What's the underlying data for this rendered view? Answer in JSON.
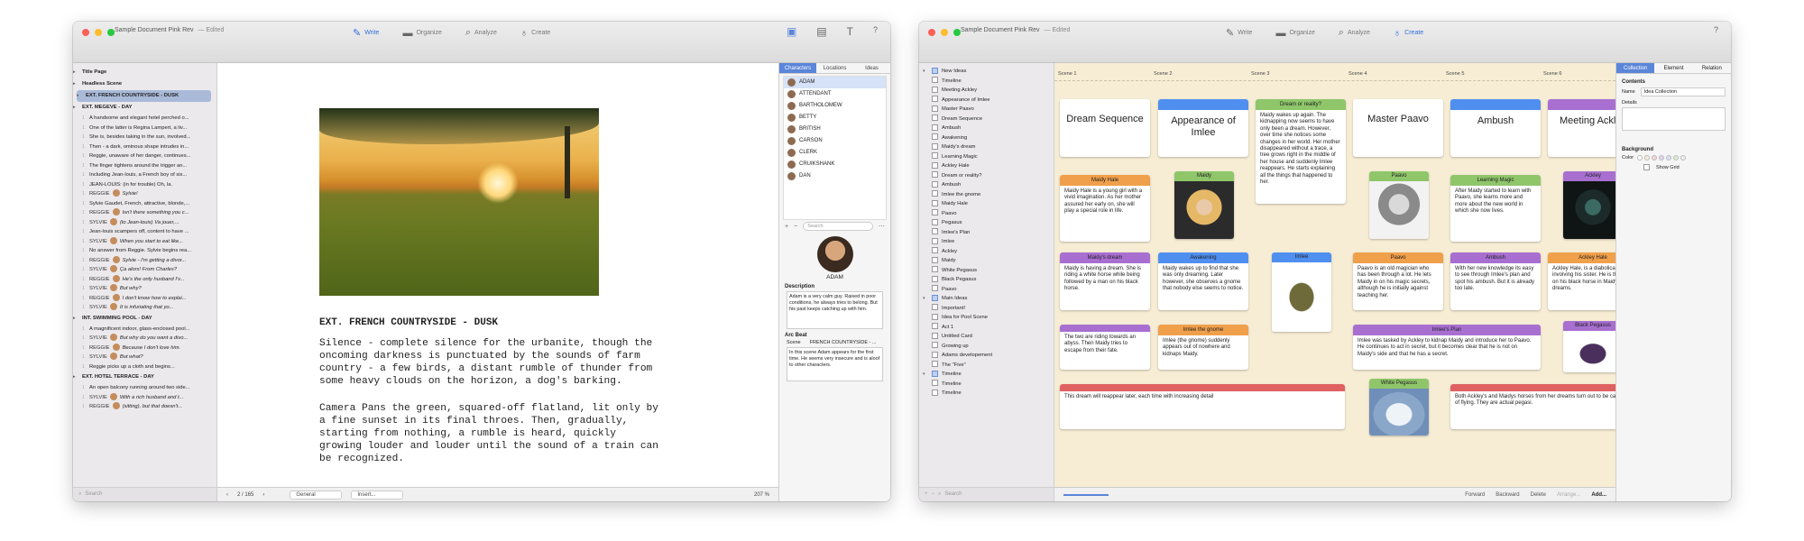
{
  "window1": {
    "title": "Sample Document Pink Rev",
    "edited": "— Edited",
    "modes": [
      "Write",
      "Organize",
      "Analyze",
      "Create"
    ],
    "binder": [
      {
        "label": "Title Page",
        "type": "hdr"
      },
      {
        "label": "Headless Scene",
        "type": "hdr"
      },
      {
        "label": "EXT. FRENCH COUNTRYSIDE - DUSK",
        "type": "sel"
      },
      {
        "label": "EXT. MEGEVE - DAY",
        "type": "hdr"
      },
      {
        "label": "A handsome and elegant hotel perched o...",
        "num": "1"
      },
      {
        "label": "One of the latter is Regina Lampert, a liv...",
        "num": "1"
      },
      {
        "label": "She is, besides taking in the sun, involved...",
        "num": "1"
      },
      {
        "label": "Then - a dark, ominous shape intrudes in...",
        "num": "1"
      },
      {
        "label": "Reggie, unaware of her danger, continues...",
        "num": "1"
      },
      {
        "label": "The finger tightens around the trigger an...",
        "num": "1"
      },
      {
        "label": "Including Jean-louis, a French boy of six...",
        "num": "1"
      },
      {
        "label": "JEAN-LOUIS: (in for trouble)  Oh, la.",
        "num": "1"
      },
      {
        "label": "Sylvie!",
        "num": "1",
        "char": "REGGIE",
        "av": true
      },
      {
        "label": "Sylvie Gaudet, French, attractive, blonde,...",
        "num": "1"
      },
      {
        "label": "Isn't there something you c...",
        "num": "1",
        "char": "REGGIE",
        "av": true
      },
      {
        "label": "(to Jean-louis)  Va jouer,...",
        "num": "1",
        "char": "SYLVIE",
        "av": true
      },
      {
        "label": "Jean-louis scampers off, content to have ...",
        "num": "1"
      },
      {
        "label": "When you start to eat like...",
        "num": "1",
        "char": "SYLVIE",
        "av": true
      },
      {
        "label": "No answer from Reggie. Sylvie begins rea...",
        "num": "1"
      },
      {
        "label": "Sylvie - I'm getting a divor...",
        "num": "1",
        "char": "REGGIE",
        "av": true
      },
      {
        "label": "Ça alors! From Charles?",
        "num": "1",
        "char": "SYLVIE",
        "av": true
      },
      {
        "label": "He's the only husband I'v...",
        "num": "1",
        "char": "REGGIE",
        "av": true
      },
      {
        "label": "But why?",
        "num": "1",
        "char": "SYLVIE",
        "av": true
      },
      {
        "label": "I don't know how to explai...",
        "num": "1",
        "char": "REGGIE",
        "av": true
      },
      {
        "label": "It is infuriating that yo...",
        "num": "1",
        "char": "SYLVIE",
        "av": true
      },
      {
        "label": "INT. SWIMMING POOL - DAY",
        "type": "hdr"
      },
      {
        "label": "A magnificent indoor, glass-enclosed pool...",
        "num": "1"
      },
      {
        "label": "But why do you want a divo...",
        "num": "1",
        "char": "SYLVIE",
        "av": true
      },
      {
        "label": "Because I don't love him.",
        "num": "1",
        "char": "REGGIE",
        "av": true
      },
      {
        "label": "But what?",
        "num": "1",
        "char": "SYLVIE",
        "av": true
      },
      {
        "label": "Reggie picks up a cloth and begins...",
        "num": "1"
      },
      {
        "label": "EXT. HOTEL TERRACE - DAY",
        "type": "hdr"
      },
      {
        "label": "An open balcony running around two side...",
        "num": "1"
      },
      {
        "label": "With a rich husband and t...",
        "num": "1",
        "char": "SYLVIE",
        "av": true
      },
      {
        "label": "(sitting), but that doesn't...",
        "num": "1",
        "char": "REGGIE",
        "av": true
      }
    ],
    "search_placeholder": "Search",
    "scene_heading": "EXT. FRENCH COUNTRYSIDE - DUSK",
    "paragraphs": [
      "Silence - complete silence for the urbanite, though the oncoming darkness is punctuated by the sounds of farm country - a few birds, a distant rumble of thunder from some heavy clouds on the horizon, a dog's barking.",
      "Camera Pans the green, squared-off flatland, lit only by a fine sunset in its final throes. Then, gradually, starting from nothing, a rumble is heard, quickly growing louder and louder until the sound of a train can be recognized."
    ],
    "footer": {
      "page": "2 / 165",
      "style": "General",
      "insert": "Insert...",
      "zoom": "207 %"
    },
    "inspector": {
      "tabs": [
        "Characters",
        "Locations",
        "Ideas"
      ],
      "characters": [
        "ADAM",
        "ATTENDANT",
        "BARTHOLOMEW",
        "BETTY",
        "BRITISH",
        "CARSON",
        "CLERK",
        "CRUIKSHANK",
        "DAN"
      ],
      "search_placeholder": "Search",
      "selected_name": "ADAM",
      "description_label": "Description",
      "description": "Adam is a very calm guy. Raised in poor conditions, he always tries to belong. But his past keeps catching up with him.",
      "arc_label": "Arc Beat",
      "scene_label": "Scene",
      "scene_value": "FRENCH COUNTRYSIDE - ...",
      "arc_text": "In this scene Adam appears for the first time. He seems very insecure and is aloof to other characters."
    }
  },
  "window2": {
    "title": "Sample Document Pink Rev",
    "edited": "— Edited",
    "modes": [
      "Write",
      "Organize",
      "Analyze",
      "Create"
    ],
    "binder": [
      {
        "label": "New Ideas",
        "type": "folder"
      },
      {
        "label": "Timeline"
      },
      {
        "label": "Meeting Ackley"
      },
      {
        "label": "Appearance of Imlee"
      },
      {
        "label": "Master Paavo"
      },
      {
        "label": "Dream Sequence"
      },
      {
        "label": "Ambush"
      },
      {
        "label": "Awakening"
      },
      {
        "label": "Maidy's dream"
      },
      {
        "label": "Learning Magic"
      },
      {
        "label": "Ackley Hale"
      },
      {
        "label": "Dream or reality?"
      },
      {
        "label": "Ambush"
      },
      {
        "label": "Imlee the gnome"
      },
      {
        "label": "Maidy Hale"
      },
      {
        "label": "Paavo"
      },
      {
        "label": "Pegasus"
      },
      {
        "label": "Imlee's Plan"
      },
      {
        "label": "Imlee"
      },
      {
        "label": "Ackley"
      },
      {
        "label": "Maidy"
      },
      {
        "label": "White Pegasus"
      },
      {
        "label": "Black Pegasus"
      },
      {
        "label": "Paavo"
      },
      {
        "label": "Main Ideas",
        "type": "folder"
      },
      {
        "label": "Important!"
      },
      {
        "label": "Idea for Pool Scene"
      },
      {
        "label": "Act 1"
      },
      {
        "label": "Untitled Card"
      },
      {
        "label": "Growing up"
      },
      {
        "label": "Adams developement"
      },
      {
        "label": "The \"Five\""
      },
      {
        "label": "Timeline",
        "type": "folder"
      },
      {
        "label": "Timeline"
      },
      {
        "label": "Timeline"
      }
    ],
    "search_placeholder": "Search",
    "scenes": [
      "Scene 1",
      "Scene 2",
      "Scene 3",
      "Scene 4",
      "Scene 5",
      "Scene 6"
    ],
    "cards": {
      "dream_sequence": {
        "title": "Dream Sequence"
      },
      "appearance": {
        "title": "Appearance of Imlee"
      },
      "dream_reality": {
        "head": "Dream or reality?",
        "text": "Maidy wakes up again. The kidnapping now seems to have only been a dream. However, over time she notices some changes in her world. Her mother disappeared without a trace, a tree grows right in the middle of her house and suddenly Imlee reappears. He starts explaining all the things that happened to her."
      },
      "master_paavo": {
        "title": "Master Paavo"
      },
      "ambush_big": {
        "title": "Ambush"
      },
      "meeting_ackley": {
        "title": "Meeting Ackley"
      },
      "maidy_hale": {
        "head": "Maidy Hale",
        "text": "Maidy Hale is a young girl with a vivid imagination. As her mother assured her early on, she will play a special role in life."
      },
      "maidy_img": {
        "head": "Maidy"
      },
      "paavo_img": {
        "head": "Paavo"
      },
      "learning_magic": {
        "head": "Learning Magic",
        "text": "After Maidy started to learn with Paavo, she learns more and more about the new world in which she now lives."
      },
      "ackley_img": {
        "head": "Ackley"
      },
      "maidys_dream": {
        "head": "Maidy's dream",
        "text": "Maidy is having a dream. She is riding a white horse while being followed by a man on his black horse."
      },
      "awakening": {
        "head": "Awakening",
        "text": "Maidy wakes up to find that she was only dreaming. Later however, she observes a gnome that nobody else seems to notice."
      },
      "imlee_img": {
        "head": "Imlee"
      },
      "paavo": {
        "head": "Paavo",
        "text": "Paavo is an old magician who has been through a lot. He lets Maidy in on his magic secrets, although he is initially against teaching her."
      },
      "ambush": {
        "head": "Ambush",
        "text": "With her new knowledge its easy to see through Imlee's plan and spot his ambush. But it is already too late."
      },
      "ackley_hale": {
        "head": "Ackley Hale",
        "text": "Ackley Hale, is a diabolical plan involving his sister. He is the man on his black horse in Maidy's dreams."
      },
      "riding": {
        "text": "The two are riding towards an abyss. Then Maidy tries to escape from their fate."
      },
      "imlee_gnome": {
        "head": "Imlee the gnome",
        "text": "Imlee (the gnome) suddenly appears out of nowhere and kidnaps Maidy."
      },
      "imlee_plan": {
        "head": "Imlee's Plan",
        "text": "Imlee was tasked by Ackley to kidnap Maidy and introduce her to Paavo. He continues to act in secret, but it becomes clear that he is not on Maidy's side and that he has a secret."
      },
      "black_pegasus": {
        "head": "Black Pegasus"
      },
      "dream_reappear": {
        "text": "This dream will reappear later, each time with increasing detail"
      },
      "white_pegasus": {
        "head": "White Pegasus"
      },
      "both_horses": {
        "text": "Both Ackley's and Maidys horses from her dreams turn out to be capable of flying. They are actual pegasi."
      }
    },
    "footer": [
      "Forward",
      "Backward",
      "Delete",
      "Arrange...",
      "Add..."
    ],
    "inspector": {
      "tabs": [
        "Collection",
        "Element",
        "Relation"
      ],
      "contents_label": "Contents",
      "name_label": "Name",
      "name_value": "Idea Collection",
      "details_label": "Details",
      "background_label": "Background",
      "color_label": "Color",
      "show_grid": "Show Grid"
    }
  },
  "colors": {
    "accent": "#5a85d8",
    "orange": "#f0a04a",
    "blue": "#4f8ff0",
    "green": "#8fc66a",
    "purple": "#a86fd1",
    "red": "#e06161",
    "canvas": "#f7edd5"
  }
}
